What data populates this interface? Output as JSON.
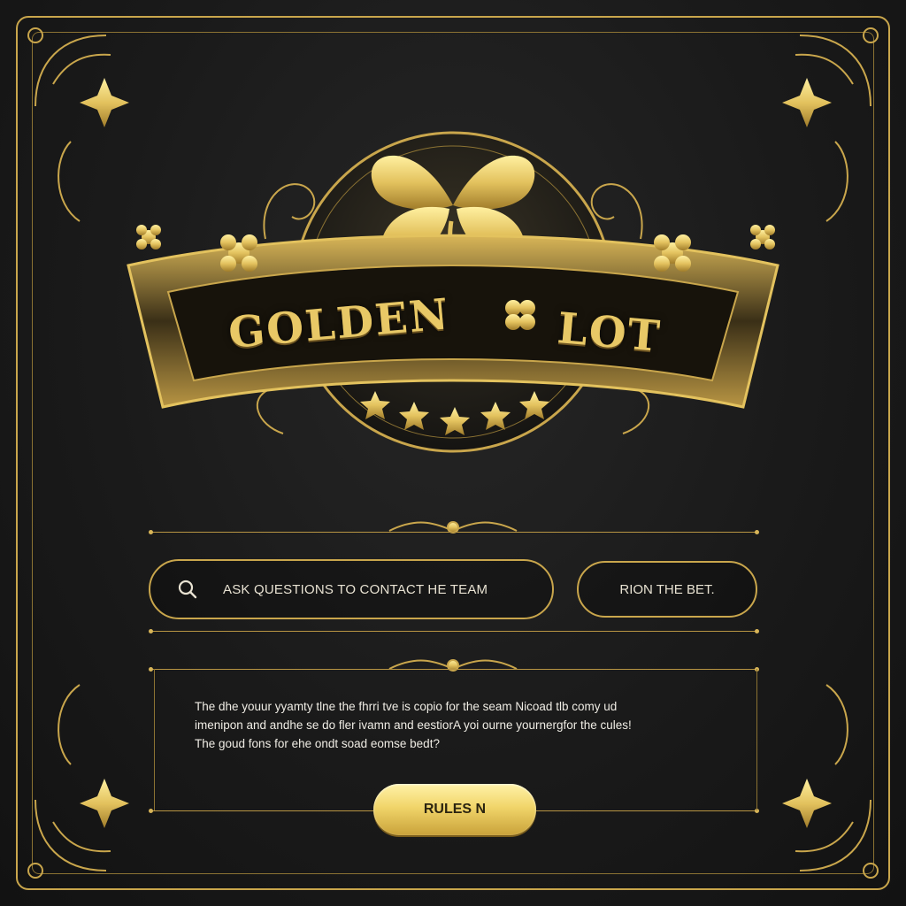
{
  "brand": {
    "title_left": "GOLDEN",
    "title_right": "LOT"
  },
  "search": {
    "label": "ASK QUESTIONS TO CONTACT HE TEAM"
  },
  "bet_button": {
    "label": "RION THE BET."
  },
  "description": {
    "lines": [
      "The dhe youur yyamty tlne the fhrri tve is copio for the seam Nicoad tlb comy ud",
      "imenipon and andhe se do fler ivamn and eestiorA yoi ourne yournergfor the cules!",
      "The goud fons for ehe ondt soad eomse bedt?"
    ]
  },
  "rules_button": {
    "label": "RULES N"
  },
  "colors": {
    "background": "#1a1a1a",
    "gold": "#c9a64c",
    "gold_light": "#f1d56a",
    "text": "#e8e2d2"
  },
  "icons": [
    "four-leaf-clover-icon",
    "search-icon",
    "star-icon",
    "flower-icon"
  ]
}
